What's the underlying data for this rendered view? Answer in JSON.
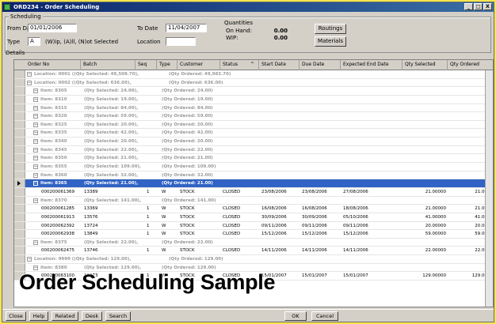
{
  "window": {
    "title": "ORD234 - Order Scheduling",
    "controls": [
      "_",
      "□",
      "X"
    ]
  },
  "scheduling": {
    "group_label": "Scheduling",
    "from_date_label": "From Date",
    "from_date_value": "01/01/2006",
    "to_date_label": "To Date",
    "to_date_value": "11/04/2007",
    "type_label": "Type",
    "type_value": "A",
    "type_hint": "(W)ip, (A)ll, (N)ot Selected",
    "location_label": "Location",
    "location_value": "",
    "quantities_label": "Quantities",
    "on_hand_label": "On Hand:",
    "on_hand_value": "0.00",
    "wip_label": "WIP:",
    "wip_value": "0.00",
    "routings_button": "Routings",
    "materials_button": "Materials"
  },
  "details": {
    "group_label": "Details",
    "columns": [
      "Order No",
      "Batch",
      "Seq",
      "Type",
      "Customer",
      "Status",
      "Start Date",
      "Due Date",
      "Expected End Date",
      "Qty Selected",
      "Qty Ordered"
    ],
    "sort_indicator": "^",
    "rows": [
      {
        "kind": "group",
        "indent": 1,
        "text": "Location: 0001 ((Qty Selected: 49,508.70),",
        "text2": "(Qty Ordered: 49,983.70)"
      },
      {
        "kind": "group",
        "indent": 1,
        "text": "Location: 0002 ((Qty Selected: 636.00),",
        "text2": "(Qty Ordered: 636.00)"
      },
      {
        "kind": "group",
        "indent": 2,
        "text": "Item: 8305",
        "qs": "(Qty Selected: 24.00),",
        "qo": "(Qty Ordered: 24.00)"
      },
      {
        "kind": "group",
        "indent": 2,
        "text": "Item: 8310",
        "qs": "(Qty Selected: 19.00),",
        "qo": "(Qty Ordered: 19.00)"
      },
      {
        "kind": "group",
        "indent": 2,
        "text": "Item: 8315",
        "qs": "(Qty Selected: 84.00),",
        "qo": "(Qty Ordered: 84.00)"
      },
      {
        "kind": "group",
        "indent": 2,
        "text": "Item: 8320",
        "qs": "(Qty Selected: 59.00),",
        "qo": "(Qty Ordered: 59.00)"
      },
      {
        "kind": "group",
        "indent": 2,
        "text": "Item: 8325",
        "qs": "(Qty Selected: 20.00),",
        "qo": "(Qty Ordered: 20.00)"
      },
      {
        "kind": "group",
        "indent": 2,
        "text": "Item: 8335",
        "qs": "(Qty Selected: 42.00),",
        "qo": "(Qty Ordered: 42.00)"
      },
      {
        "kind": "group",
        "indent": 2,
        "text": "Item: 8340",
        "qs": "(Qty Selected: 20.00),",
        "qo": "(Qty Ordered: 20.00)"
      },
      {
        "kind": "group",
        "indent": 2,
        "text": "Item: 8345",
        "qs": "(Qty Selected: 22.00),",
        "qo": "(Qty Ordered: 22.00)"
      },
      {
        "kind": "group",
        "indent": 2,
        "text": "Item: 8350",
        "qs": "(Qty Selected: 21.00),",
        "qo": "(Qty Ordered: 21.00)"
      },
      {
        "kind": "group",
        "indent": 2,
        "text": "Item: 8355",
        "qs": "(Qty Selected: 109.00),",
        "qo": "(Qty Ordered: 109.00)"
      },
      {
        "kind": "group",
        "indent": 2,
        "text": "Item: 8360",
        "qs": "(Qty Selected: 32.00),",
        "qo": "(Qty Ordered: 32.00)"
      },
      {
        "kind": "selected",
        "indent": 2,
        "text": "Item: 8365",
        "qs": "(Qty Selected: 21.00),",
        "qo": "(Qty Ordered: 21.00)"
      },
      {
        "kind": "data",
        "order": "000200061369",
        "batch": "13389",
        "seq": "1",
        "type": "W",
        "customer": "STOCK",
        "status": "CLOSED",
        "start": "23/08/2006",
        "due": "23/08/2006",
        "end": "27/08/2006",
        "qsel": "21.00000",
        "qord": "21.0000"
      },
      {
        "kind": "group",
        "indent": 2,
        "text": "Item: 8370",
        "qs": "(Qty Selected: 141.00),",
        "qo": "(Qty Ordered: 141.00)"
      },
      {
        "kind": "data",
        "order": "000200061285",
        "batch": "13369",
        "seq": "1",
        "type": "W",
        "customer": "STOCK",
        "status": "CLOSED",
        "start": "16/08/2006",
        "due": "16/08/2006",
        "end": "18/08/2006",
        "qsel": "21.00000",
        "qord": "21.0000"
      },
      {
        "kind": "data",
        "order": "000200061913",
        "batch": "13576",
        "seq": "1",
        "type": "W",
        "customer": "STOCK",
        "status": "CLOSED",
        "start": "30/09/2006",
        "due": "30/09/2006",
        "end": "05/10/2006",
        "qsel": "41.00000",
        "qord": "41.0000"
      },
      {
        "kind": "data",
        "order": "000200062392",
        "batch": "13724",
        "seq": "1",
        "type": "W",
        "customer": "STOCK",
        "status": "CLOSED",
        "start": "09/11/2006",
        "due": "09/11/2006",
        "end": "09/11/2006",
        "qsel": "20.00000",
        "qord": "20.0000"
      },
      {
        "kind": "data",
        "order": "000200062938",
        "batch": "13849",
        "seq": "1",
        "type": "W",
        "customer": "STOCK",
        "status": "CLOSED",
        "start": "15/12/2006",
        "due": "15/12/2006",
        "end": "15/12/2006",
        "qsel": "59.00000",
        "qord": "59.0000"
      },
      {
        "kind": "group",
        "indent": 2,
        "text": "Item: 8375",
        "qs": "(Qty Selected: 22.00),",
        "qo": "(Qty Ordered: 22.00)"
      },
      {
        "kind": "data",
        "order": "000200062475",
        "batch": "13746",
        "seq": "1",
        "type": "W",
        "customer": "STOCK",
        "status": "CLOSED",
        "start": "14/11/2006",
        "due": "14/11/2006",
        "end": "14/11/2006",
        "qsel": "22.00000",
        "qord": "22.0000"
      },
      {
        "kind": "group",
        "indent": 1,
        "text": "Location: 9999 ((Qty Selected: 129.00),",
        "text2": "(Qty Ordered: 129.00)"
      },
      {
        "kind": "group",
        "indent": 2,
        "text": "Item: 8380",
        "qs": "(Qty Selected: 129.00),",
        "qo": "(Qty Ordered: 129.00)"
      },
      {
        "kind": "data",
        "order": "000200063100",
        "batch": "13873",
        "seq": "1",
        "type": "W",
        "customer": "STOCK",
        "status": "CLOSED",
        "start": "15/01/2007",
        "due": "15/01/2007",
        "end": "15/01/2007",
        "qsel": "129.00000",
        "qord": "129.0000"
      }
    ]
  },
  "footer": {
    "buttons": [
      "Close",
      "Help",
      "Related",
      "Desk",
      "Search"
    ],
    "ok": "OK",
    "cancel": "Cancel"
  },
  "watermark": "Order Scheduling Sample",
  "colors": {
    "background": "#f6e64e",
    "titlebar": "#0a246a",
    "selected_row": "#3163c5",
    "group_text": "#9a9a9a"
  }
}
